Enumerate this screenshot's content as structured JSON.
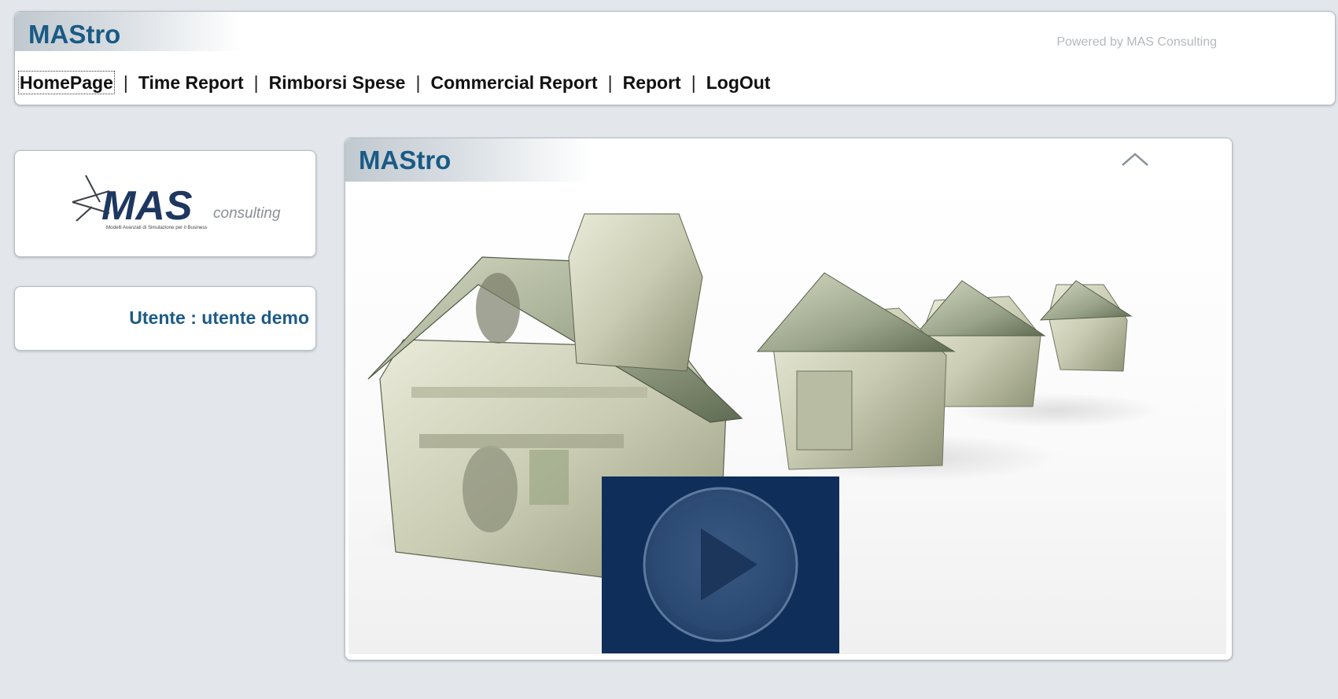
{
  "header": {
    "app_title": "MAStro",
    "powered_by": "Powered by MAS Consulting",
    "nav": [
      "HomePage",
      "Time Report",
      "Rimborsi Spese",
      "Commercial Report",
      "Report",
      "LogOut"
    ],
    "nav_separator": "|"
  },
  "logo": {
    "brand": "MAS",
    "suffix": "consulting",
    "tagline": "Modelli Avanzati di Simulazione per il Business"
  },
  "user": {
    "label": "Utente : utente demo"
  },
  "main_panel": {
    "title": "MAStro",
    "collapse_icon": "chevron-up-icon",
    "video_icon": "play-icon"
  },
  "colors": {
    "accent": "#1a5a85",
    "overlay": "#0f2e59",
    "background": "#e3e7ec"
  }
}
